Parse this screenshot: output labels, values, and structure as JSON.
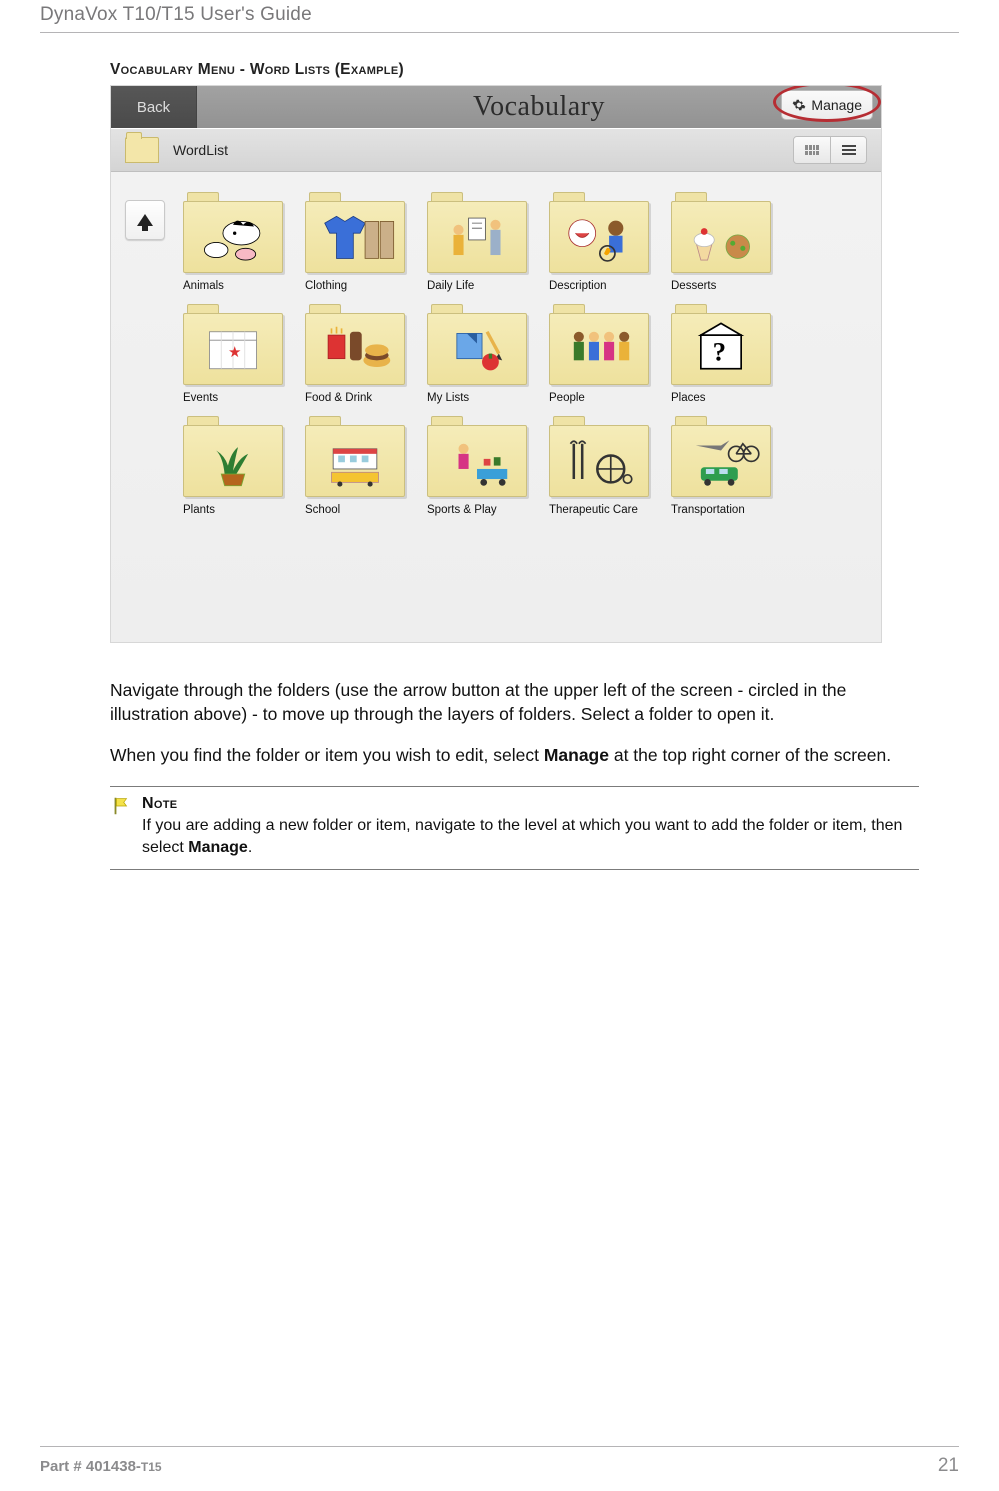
{
  "doc": {
    "running_header": "DynaVox T10/T15 User's Guide",
    "section_heading": "Vocabulary Menu - Word Lists (Example)",
    "para1_a": "Navigate through the folders (use the arrow button at the upper left of the screen - circled in the illustration above) - to move up through the layers of folders. Select a folder to open it.",
    "para2_a": "When you find the folder or item you wish to edit, select ",
    "para2_bold": "Manage",
    "para2_b": " at the top right corner of the screen.",
    "note_heading": "Note",
    "note_body_a": "If you are adding a new folder or item, navigate to the level at which you want to add the folder or item, then select ",
    "note_body_bold": "Manage",
    "note_body_b": ".",
    "footer_left_a": "Part # 401438-",
    "footer_left_b": "T15",
    "page_number": "21"
  },
  "screenshot": {
    "back_label": "Back",
    "title": "Vocabulary",
    "manage_label": "Manage",
    "path_label": "WordList",
    "folders": [
      {
        "label": "Animals",
        "icon": "animals"
      },
      {
        "label": "Clothing",
        "icon": "clothing"
      },
      {
        "label": "Daily Life",
        "icon": "daily"
      },
      {
        "label": "Description",
        "icon": "description"
      },
      {
        "label": "Desserts",
        "icon": "desserts"
      },
      {
        "label": "Events",
        "icon": "events"
      },
      {
        "label": "Food & Drink",
        "icon": "food"
      },
      {
        "label": "My Lists",
        "icon": "mylists"
      },
      {
        "label": "People",
        "icon": "people"
      },
      {
        "label": "Places",
        "icon": "places"
      },
      {
        "label": "Plants",
        "icon": "plants"
      },
      {
        "label": "School",
        "icon": "school"
      },
      {
        "label": "Sports & Play",
        "icon": "sports"
      },
      {
        "label": "Therapeutic Care",
        "icon": "therapy"
      },
      {
        "label": "Transportation",
        "icon": "transport"
      }
    ]
  }
}
